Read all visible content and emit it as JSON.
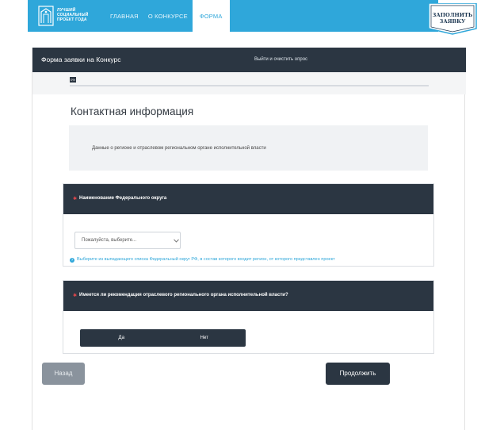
{
  "nav": {
    "logo_text": "ЛУЧШИЙ\nСОЦИАЛЬНЫЙ\nПРОЕКТ ГОДА",
    "links": [
      {
        "label": "ГЛАВНАЯ"
      },
      {
        "label": "О КОНКУРСЕ"
      },
      {
        "label": "ФОРМА"
      }
    ],
    "badge_text": "ЗАПОЛНИТЬ\nЗАЯВКУ"
  },
  "form": {
    "title": "Форма заявки на Конкурс",
    "exit_label": "Выйти и очистить опрос",
    "progress_label": "0%",
    "section_title": "Контактная информация",
    "info_text": "Данные о регионе и отраслевом региональном органе исполнительной власти",
    "q1": {
      "required_mark": "✱",
      "label": "Наименование Федерального округа",
      "select_placeholder": "Пожалуйста, выберите...",
      "hint": "Выберите из выпадающего списка Федеральный округ РФ, в состав которого входит регион, от которого представлен проект"
    },
    "q2": {
      "required_mark": "✱",
      "label": "Имеется ли рекомендация отраслевого регионального органа исполнительной власти?",
      "options": [
        {
          "label": "Да"
        },
        {
          "label": "Нет"
        }
      ]
    },
    "back_label": "Назад",
    "next_label": "Продолжить"
  },
  "colors": {
    "accent": "#2fa7da",
    "dark": "#2b3642",
    "required": "#e0474c"
  }
}
